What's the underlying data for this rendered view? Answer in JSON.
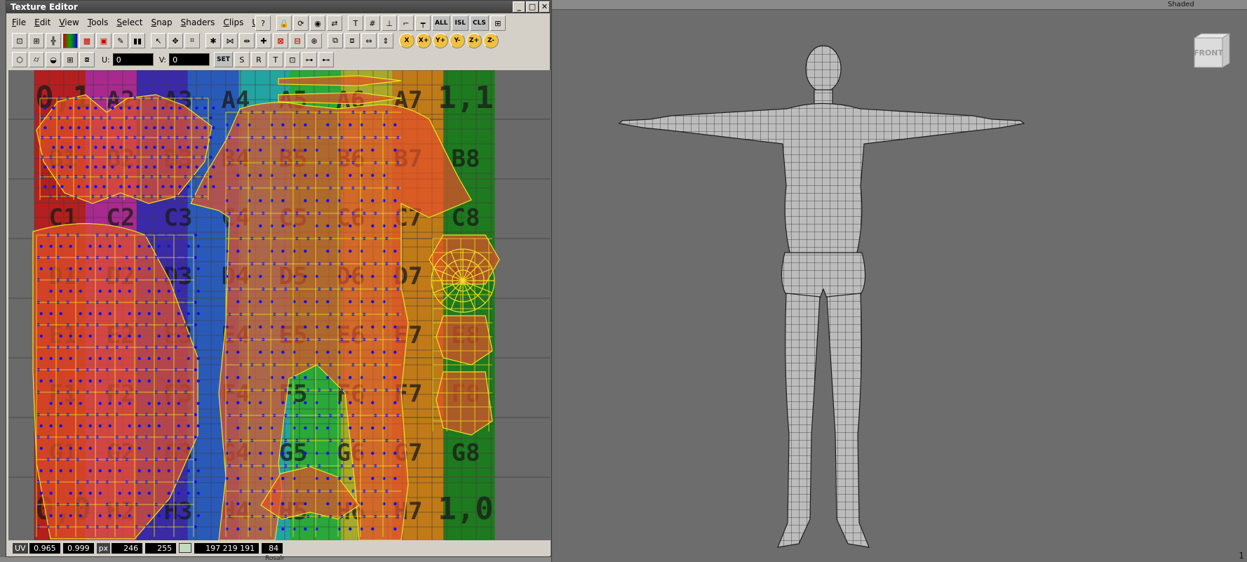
{
  "texture_editor": {
    "title": "Texture Editor",
    "window_buttons": {
      "minimize": "_",
      "maximize": "□",
      "close": "✕"
    },
    "menu": [
      "File",
      "Edit",
      "View",
      "Tools",
      "Select",
      "Snap",
      "Shaders",
      "Clips",
      "UVs"
    ],
    "toolbar_badges": {
      "all": "ALL",
      "isl": "ISL",
      "cls": "CLS",
      "set": "SET"
    },
    "axis_buttons": [
      "X",
      "X+",
      "Y+",
      "Y-",
      "Z+",
      "Z-"
    ],
    "u_label": "U:",
    "u_value": "0",
    "v_label": "V:",
    "v_value": "0",
    "grid": {
      "row_letters": [
        "A",
        "B",
        "C",
        "D",
        "E",
        "F",
        "G",
        "H"
      ],
      "corner_labels": {
        "top_left": "0,1",
        "top_right": "1,1",
        "bottom_left": "0,0",
        "bottom_right": "1,0"
      },
      "column_colors": [
        "#b31f1f",
        "#a82a8e",
        "#3a2aa8",
        "#2a5ab8",
        "#24a3a3",
        "#2aa83a",
        "#a8a82a",
        "#c07a18",
        "#1e7a1e"
      ]
    },
    "status": {
      "uv_tag": "UV",
      "uv_u": "0.965",
      "uv_v": "0.999",
      "px_tag": "px",
      "px_x": "246",
      "px_y": "255",
      "rgb": "197 219 191",
      "alpha": "84",
      "swatch_color": "#c5dbbf"
    }
  },
  "viewport": {
    "mode": "Shaded",
    "view_cube_label": "FRONT",
    "corner_number": "1",
    "bottom_label": "Rosalr"
  }
}
